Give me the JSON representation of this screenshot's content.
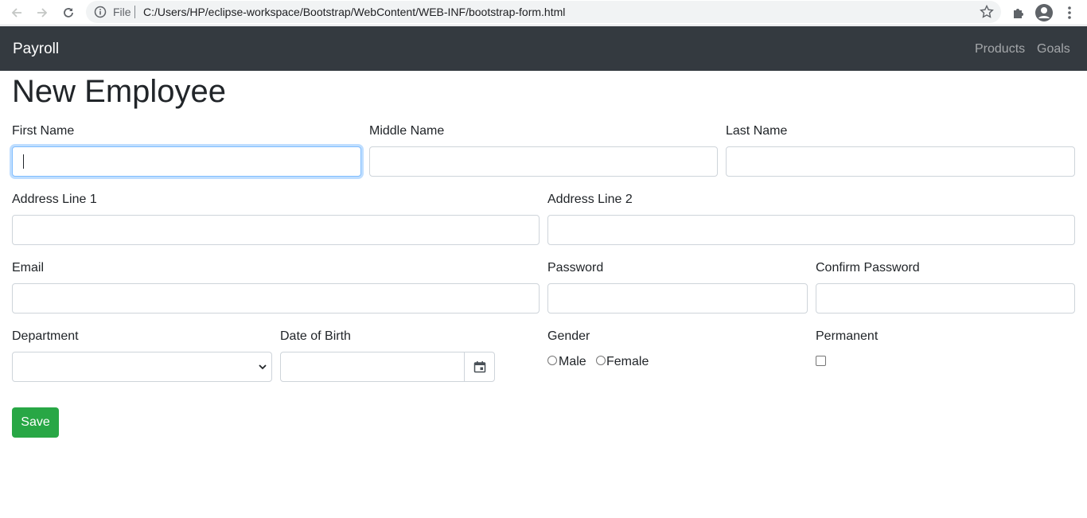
{
  "browser": {
    "file_label": "File",
    "url": "C:/Users/HP/eclipse-workspace/Bootstrap/WebContent/WEB-INF/bootstrap-form.html"
  },
  "navbar": {
    "brand": "Payroll",
    "links": [
      "Products",
      "Goals"
    ]
  },
  "form": {
    "title": "New Employee",
    "labels": {
      "first_name": "First Name",
      "middle_name": "Middle Name",
      "last_name": "Last Name",
      "address1": "Address Line 1",
      "address2": "Address Line 2",
      "email": "Email",
      "password": "Password",
      "confirm_password": "Confirm Password",
      "department": "Department",
      "dob": "Date of Birth",
      "gender": "Gender",
      "permanent": "Permanent"
    },
    "gender_options": [
      "Male",
      "Female"
    ],
    "save_label": "Save"
  },
  "colors": {
    "navbar_bg": "#343a40",
    "save_button": "#28a745",
    "focus_border": "#80bdff"
  }
}
